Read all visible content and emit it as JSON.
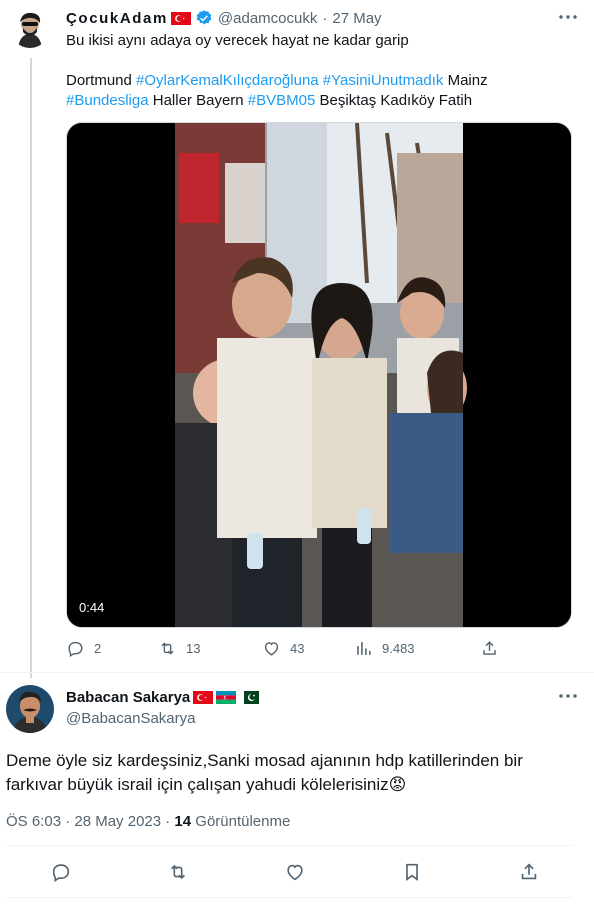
{
  "tweet": {
    "author_name": "ÇocukAdam",
    "handle": "@adamcocukk",
    "date": "27 May",
    "text_line1": "Bu ikisi aynı adaya oy verecek hayat ne kadar garip",
    "hashtags_line": {
      "w1": "Dortmund ",
      "h1": "#OylarKemalKılıçdaroğluna",
      "h2": "#YasiniUnutmadık",
      "w2": " Mainz",
      "h3": "#Bundesliga",
      "w3": " Haller Bayern ",
      "h4": "#BVBM05",
      "w4": " Beşiktaş Kadıköy Fatih"
    },
    "video_duration": "0:44",
    "replies": "2",
    "retweets": "13",
    "likes": "43",
    "views": "9.483"
  },
  "reply": {
    "author_name": "Babacan Sakarya",
    "handle": "@BabacanSakarya",
    "text": "Deme öyle siz kardeşsiniz,Sanki mosad ajanının hdp katillerinden bir farkıvar  büyük israil için çalışan yahudi kölelerisiniz",
    "emoji": "😡",
    "timestamp": "ÖS 6:03 · 28 May 2023 · ",
    "view_count": "14",
    "view_label": " Görüntülenme"
  },
  "colors": {
    "link": "#1d9bf0",
    "muted": "#536471",
    "text": "#0f1419"
  },
  "icons": [
    "verified-icon",
    "more-icon",
    "reply-icon",
    "retweet-icon",
    "like-icon",
    "views-icon",
    "share-icon",
    "bookmark-icon"
  ]
}
